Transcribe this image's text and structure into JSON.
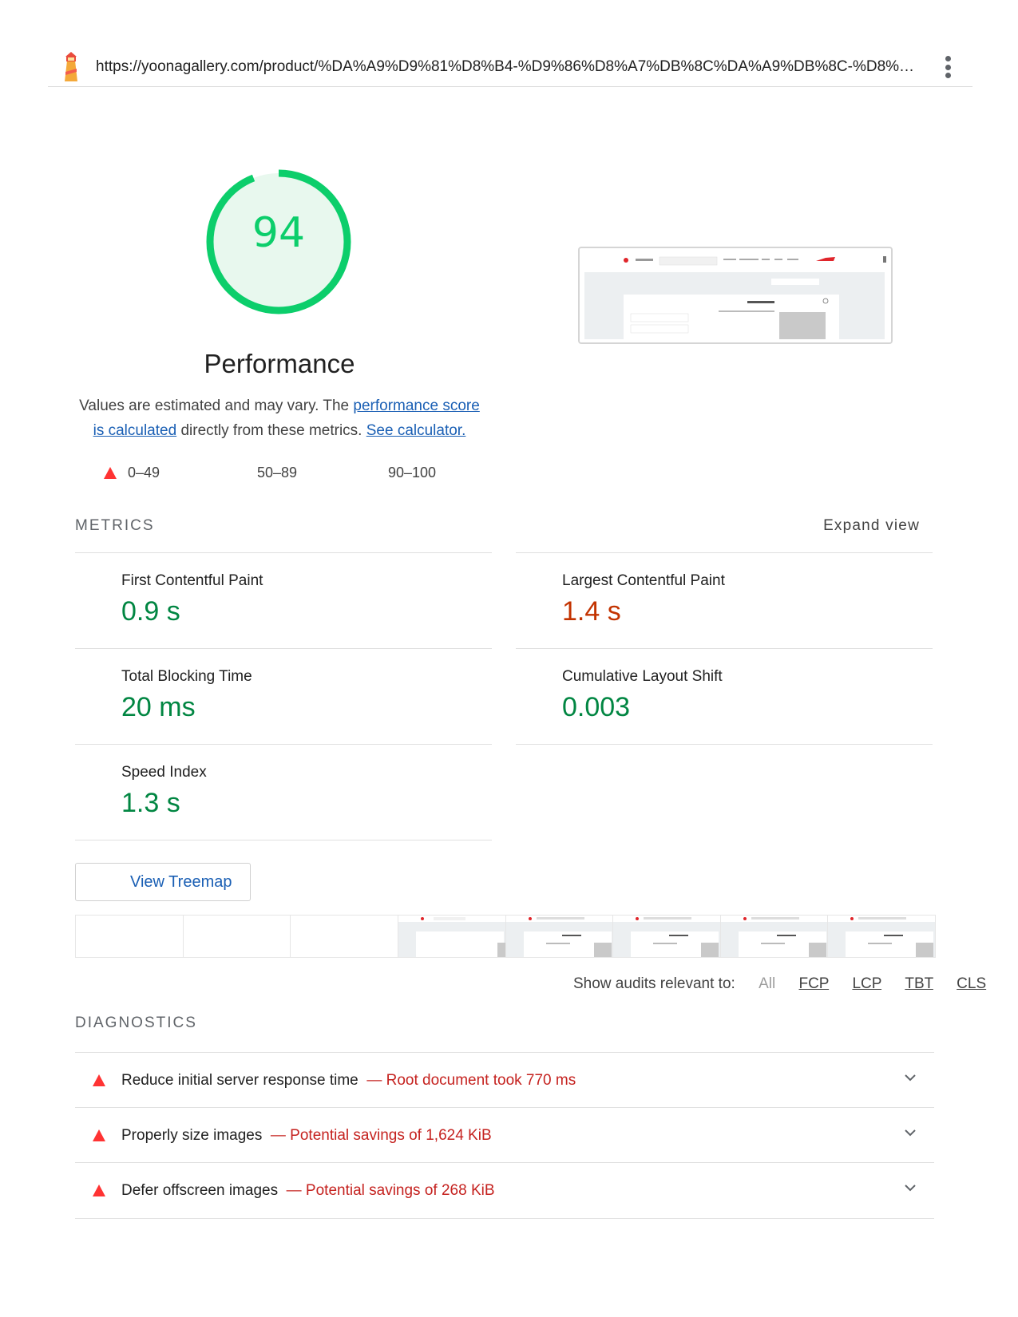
{
  "header": {
    "url": "https://yoonagallery.com/product/%DA%A9%D9%81%D8%B4-%D9%86%D8%A7%DB%8C%DA%A9%DB%8C-%D8%A…",
    "logo_icon": "lighthouse-icon",
    "menu_icon": "kebab-menu-icon"
  },
  "performance": {
    "score": "94",
    "score_fraction": 0.94,
    "title": "Performance",
    "desc_prefix": "Values are estimated and may vary. The ",
    "desc_link1": "performance score is calculated",
    "desc_middle": " directly from these metrics. ",
    "desc_link2": "See calculator."
  },
  "legend": {
    "fail": "0–49",
    "average": "50–89",
    "pass": "90–100"
  },
  "metrics": {
    "header": "METRICS",
    "expand": "Expand view",
    "fcp": {
      "name": "First Contentful Paint",
      "value": "0.9 s"
    },
    "lcp": {
      "name": "Largest Contentful Paint",
      "value": "1.4 s"
    },
    "tbt": {
      "name": "Total Blocking Time",
      "value": "20 ms"
    },
    "cls": {
      "name": "Cumulative Layout Shift",
      "value": "0.003"
    },
    "si": {
      "name": "Speed Index",
      "value": "1.3 s"
    }
  },
  "treemap": {
    "label": "View Treemap"
  },
  "filter": {
    "label": "Show audits relevant to:",
    "all": "All",
    "fcp": "FCP",
    "lcp": "LCP",
    "tbt": "TBT",
    "cls": "CLS"
  },
  "diagnostics": {
    "header": "DIAGNOSTICS",
    "items": [
      {
        "title": "Reduce initial server response time",
        "display": "— Root document took 770 ms"
      },
      {
        "title": "Properly size images",
        "display": "— Potential savings of 1,624 KiB"
      },
      {
        "title": "Defer offscreen images",
        "display": "— Potential savings of 268 KiB"
      }
    ]
  },
  "colors": {
    "pass": "#0cce6b",
    "pass_text": "#018642",
    "average_text": "#c33300",
    "fail": "#ff3333",
    "fail_text": "#c5221f",
    "link": "#1a5fb4"
  }
}
